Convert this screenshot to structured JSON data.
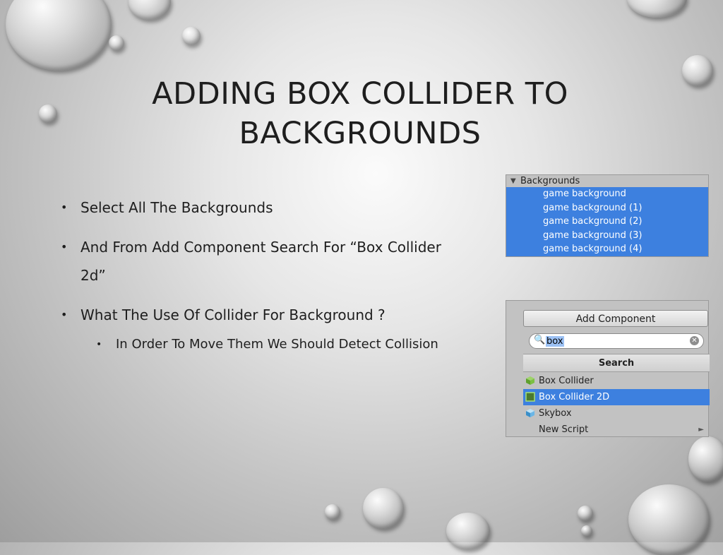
{
  "slide": {
    "title_line1": "ADDING BOX COLLIDER TO",
    "title_line2": "BACKGROUNDS",
    "bullets": [
      {
        "text": "Select All The Backgrounds"
      },
      {
        "text": "And From Add Component Search For “Box Collider 2d”"
      },
      {
        "text": "What The Use Of Collider For Background ?"
      }
    ],
    "sub_bullet": "In Order To Move Them We Should Detect Collision"
  },
  "hierarchy": {
    "root_label": "Backgrounds",
    "items": [
      "game background",
      "game background (1)",
      "game background (2)",
      "game background (3)",
      "game background (4)"
    ],
    "selection_color": "#3d80df"
  },
  "add_component": {
    "button_label": "Add Component",
    "search_value": "box",
    "section_header": "Search",
    "results": [
      {
        "label": "Box Collider",
        "icon": "cube-icon"
      },
      {
        "label": "Box Collider 2D",
        "icon": "box-collider-2d-icon",
        "selected": true
      },
      {
        "label": "Skybox",
        "icon": "skybox-icon"
      },
      {
        "label": "New Script",
        "icon": "chevron-right-icon"
      }
    ]
  }
}
